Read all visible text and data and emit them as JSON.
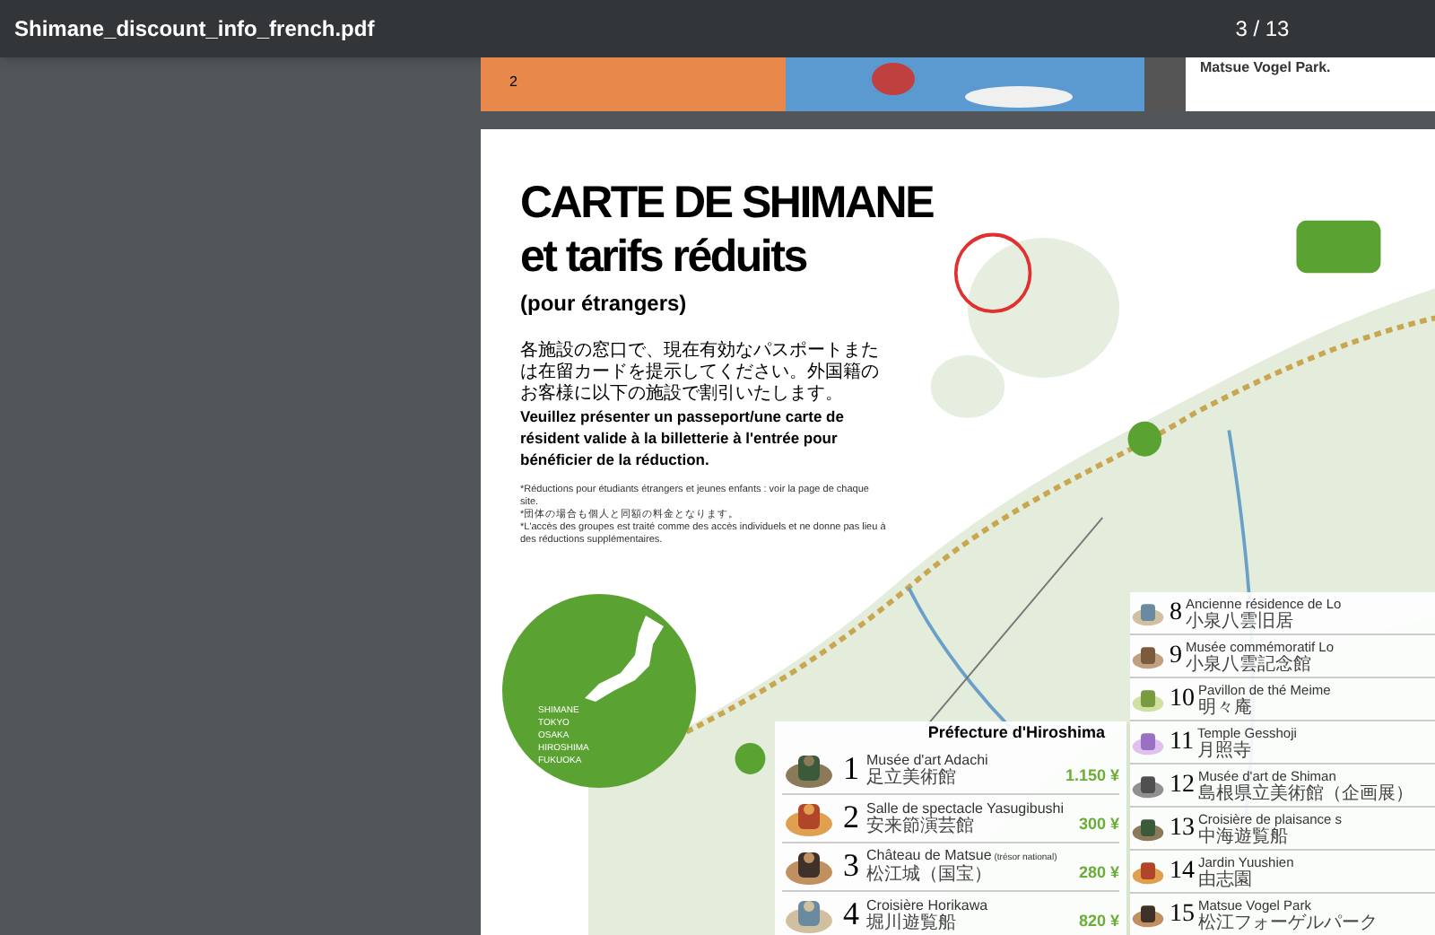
{
  "toolbar": {
    "title": "Shimane_discount_info_french.pdf",
    "page_indicator": "3 / 13"
  },
  "previous_page": {
    "page_number": "2",
    "caption": "Matsue Vogel Park."
  },
  "page": {
    "title_line_1": "CARTE DE SHIMANE",
    "title_line_2": "et tarifs réduits",
    "subtitle": "(pour étrangers)",
    "intro_japanese": "各施設の窓口で、現在有効なパスポートまたは在留カードを提示してください。外国籍のお客様に以下の施設で割引いたします。",
    "intro_french": "Veuillez présenter un passeport/une carte de résident valide à la billetterie à l'entrée pour bénéficier de la réduction.",
    "notes": [
      "*Réductions pour étudiants étrangers et jeunes enfants : voir la page de chaque site.",
      "*団体の場合も個人と同額の料金となります。",
      "*L'accès des groupes est traité comme des accès individuels et ne donne pas lieu à des réductions supplémentaires."
    ],
    "japan_map_labels": [
      "SHIMANE",
      "TOKYO",
      "OSAKA",
      "HIROSHIMA",
      "FUKUOKA"
    ],
    "hiroshima_list": {
      "heading": "Préfecture d'Hiroshima",
      "items": [
        {
          "number": "1",
          "name": "Musée d'art Adachi",
          "japanese": "足立美術館",
          "price": "1.150 ¥"
        },
        {
          "number": "2",
          "name": "Salle de spectacle Yasugibushi",
          "japanese": "安来節演芸館",
          "price": "300 ¥"
        },
        {
          "number": "3",
          "name": "Château de Matsue",
          "note": "(trésor national)",
          "japanese": "松江城（国宝）",
          "price": "280 ¥"
        },
        {
          "number": "4",
          "name": "Croisière Horikawa",
          "japanese": "堀川遊覧船",
          "price": "820 ¥"
        }
      ]
    },
    "right_list": [
      {
        "number": "8",
        "name": "Ancienne résidence de Lo",
        "japanese": "小泉八雲旧居"
      },
      {
        "number": "9",
        "name": "Musée commémoratif Lo",
        "japanese": "小泉八雲記念館"
      },
      {
        "number": "10",
        "name": "Pavillon de thé Meime",
        "japanese": "明々庵"
      },
      {
        "number": "11",
        "name": "Temple Gesshoji",
        "japanese": "月照寺"
      },
      {
        "number": "12",
        "name": "Musée d'art de Shiman",
        "japanese": "島根県立美術館（企画展）"
      },
      {
        "number": "13",
        "name": "Croisière de plaisance s",
        "japanese": "中海遊覧船"
      },
      {
        "number": "14",
        "name": "Jardin Yuushien",
        "japanese": "由志園"
      },
      {
        "number": "15",
        "name": "Matsue Vogel Park",
        "japanese": "松江フォーゲルパーク"
      }
    ]
  }
}
